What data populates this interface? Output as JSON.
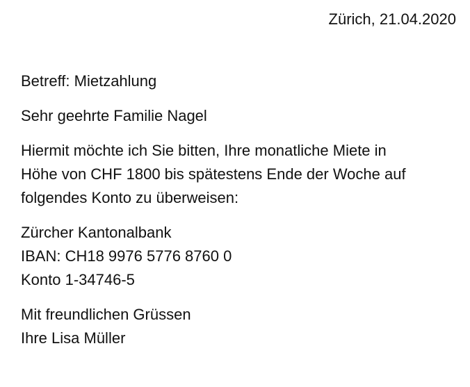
{
  "letter": {
    "date_line": "Zürich, 21.04.2020",
    "subject": "Betreff: Mietzahlung",
    "salutation": "Sehr geehrte Familie Nagel",
    "body_lines": [
      "Hiermit möchte ich Sie bitten, Ihre monatliche Miete in",
      "Höhe von CHF 1800 bis spätestens Ende der Woche auf",
      "folgendes Konto zu überweisen:"
    ],
    "bank_lines": [
      "Zürcher Kantonalbank",
      "IBAN: CH18 9976 5776 8760 0",
      "Konto 1-34746-5"
    ],
    "closing": "Mit freundlichen Grüssen",
    "signature": "Ihre Lisa Müller"
  }
}
